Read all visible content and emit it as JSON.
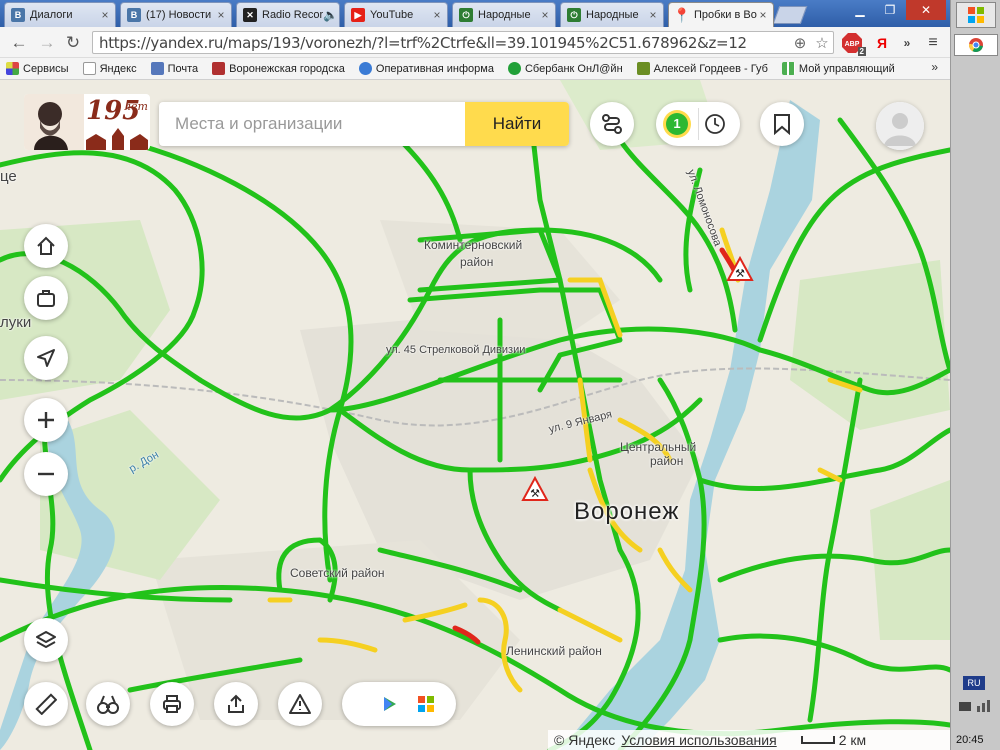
{
  "browser": {
    "tabs": [
      {
        "title": "Диалоги",
        "favicon": "vk-icon",
        "color": "#4a76a8",
        "glyph": "В"
      },
      {
        "title": "(17) Новости",
        "favicon": "vk-icon",
        "color": "#4a76a8",
        "glyph": "В"
      },
      {
        "title": "Radio Record",
        "favicon": "radio-icon",
        "color": "#222222",
        "glyph": "✕"
      },
      {
        "title": "YouTube",
        "favicon": "youtube-icon",
        "color": "#e62117",
        "glyph": "▶"
      },
      {
        "title": "Народные",
        "favicon": "power-icon",
        "color": "#2e7d32",
        "glyph": "⏻"
      },
      {
        "title": "Народные",
        "favicon": "power-icon",
        "color": "#2e7d32",
        "glyph": "⏻"
      },
      {
        "title": "Пробки в Воронеже",
        "favicon": "map-pin-icon",
        "color": "#e62117",
        "glyph": "●"
      }
    ],
    "url": "https://yandex.ru/maps/193/voronezh/?l=trf%2Ctrfe&ll=39.101945%2C51.678962&z=12",
    "extensions": {
      "adblock_label": "ABP",
      "adblock_count": "2",
      "yandex_label": "Я"
    },
    "bookmarks": [
      {
        "label": "Сервисы",
        "icon": "apps-icon",
        "color": "#d44"
      },
      {
        "label": "Яндекс",
        "icon": "page-icon",
        "color": "#ddd"
      },
      {
        "label": "Почта",
        "icon": "mail-icon",
        "color": "#5577bb"
      },
      {
        "label": "Воронежская городска",
        "icon": "crest-icon",
        "color": "#b03030"
      },
      {
        "label": "Оперативная информа",
        "icon": "gear-icon",
        "color": "#3a7bd5"
      },
      {
        "label": "Сбербанк ОнЛ@йн",
        "icon": "sber-icon",
        "color": "#21a038"
      },
      {
        "label": "Алексей Гордеев - Губ",
        "icon": "stat-icon",
        "color": "#6b8e23"
      },
      {
        "label": "Мой управляющий",
        "icon": "grid-icon",
        "color": "#4caf50"
      }
    ]
  },
  "map": {
    "search_placeholder": "Места и организации",
    "search_button": "Найти",
    "traffic_level": "1",
    "labels": {
      "district_komintern_1": "Коминтерновский",
      "district_komintern_2": "район",
      "district_central_1": "Центральный",
      "district_central_2": "район",
      "district_lenin": "Ленинский район",
      "district_sovetsky": "Советский район",
      "city": "Воронеж",
      "street_lomonosov": "ул. Ломоносова",
      "street_9jan": "ул. 9 Января",
      "street_45": "ул. 45 Стрелковой Дивизии",
      "river_don": "р. Дон",
      "left_edge_1": "це",
      "left_edge_2": "луки"
    },
    "footer": {
      "copyright": "© Яндекс",
      "terms": "Условия использования",
      "scale": "2 км"
    },
    "colors": {
      "road_free": "#22c21a",
      "road_slow": "#f5d021",
      "road_jam": "#e0261b",
      "water": "#aad3df"
    }
  },
  "taskbar": {
    "lang": "RU",
    "time": "20:45"
  }
}
